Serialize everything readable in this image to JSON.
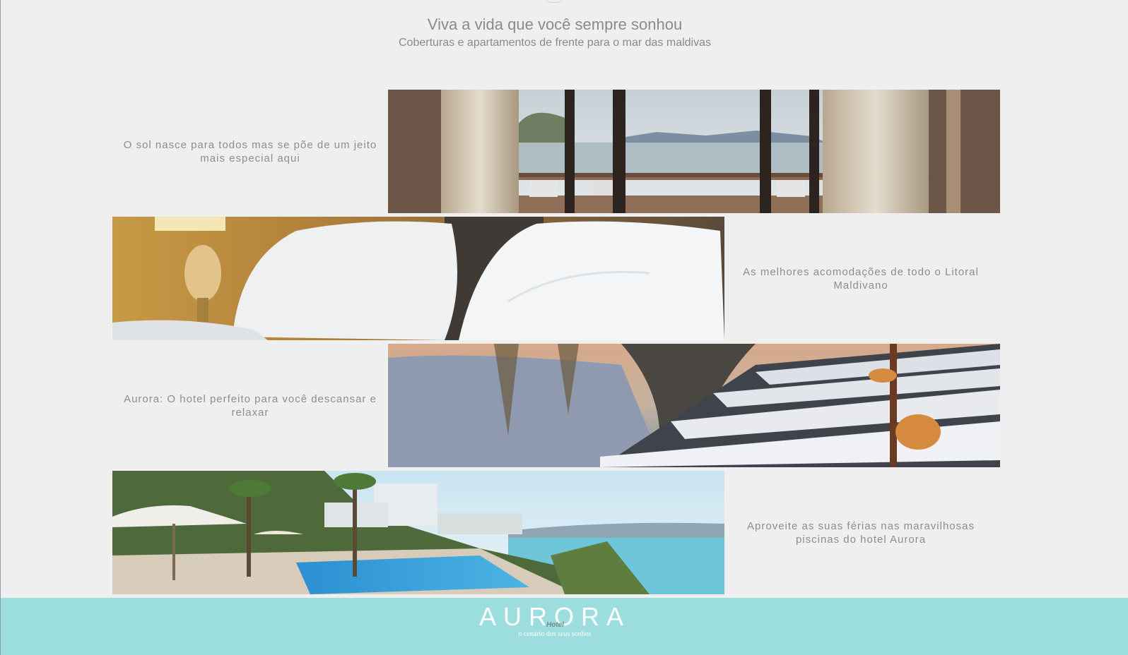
{
  "hero": {
    "title": "Viva a vida que você sempre sonhou",
    "subtitle": "Coberturas e apartamentos de frente para o mar das maldivas"
  },
  "rows": [
    {
      "caption": "O sol nasce para todos mas se põe de um jeito mais especial aqui",
      "image": "balcony-ocean-view"
    },
    {
      "caption": "As melhores acomodações de todo o Litoral Maldivano",
      "image": "bedroom-pillows"
    },
    {
      "caption": "Aurora: O hotel perfeito para você descansar e relaxar",
      "image": "pool-loungers"
    },
    {
      "caption": "Aproveite as suas férias nas maravilhosas piscinas do hotel Aurora",
      "image": "resort-pool-coast"
    }
  ],
  "footer": {
    "brand": "AURORA",
    "brand_sub": "Hotel",
    "tagline": "o cenário dos seus sonhos",
    "background": "#9bdedd"
  }
}
